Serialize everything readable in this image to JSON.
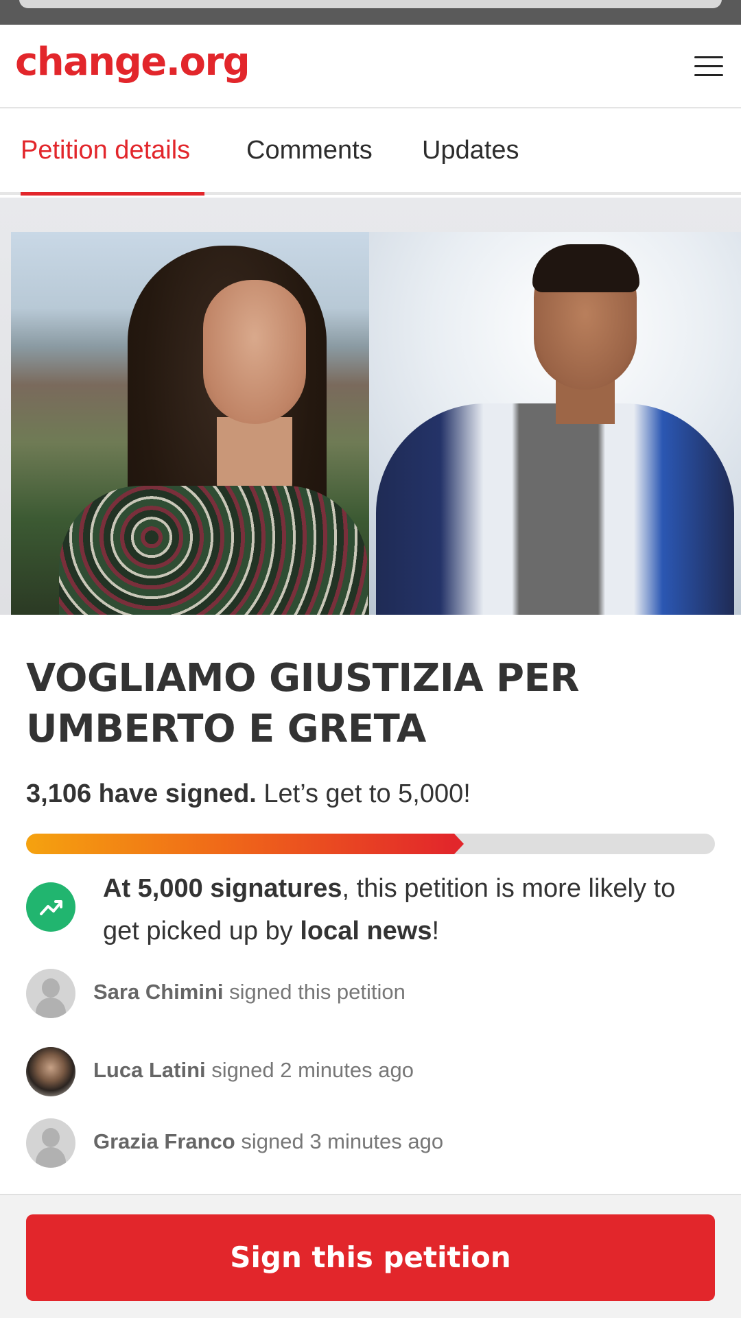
{
  "header": {
    "logo_text": "change.org",
    "menu_icon": "hamburger-icon"
  },
  "tabs": [
    {
      "label": "Petition details",
      "active": true
    },
    {
      "label": "Comments",
      "active": false
    },
    {
      "label": "Updates",
      "active": false
    }
  ],
  "petition": {
    "title": "VOGLIAMO GIUSTIZIA PER UMBERTO E GRETA",
    "signed_count_text": "3,106 have signed.",
    "goal_text": "Let’s get to 5,000!",
    "progress_fraction": 0.6212
  },
  "milestone": {
    "icon": "trending-up-icon",
    "bold_1": "At 5,000 signatures",
    "text_1": ", this petition is more likely to get picked up by ",
    "bold_2": "local news",
    "text_2": "!"
  },
  "signers": [
    {
      "name": "Sara Chimini",
      "action": " signed this petition",
      "avatar": "default-avatar-icon"
    },
    {
      "name": "Luca Latini",
      "action": " signed 2 minutes ago",
      "avatar": "user-photo"
    },
    {
      "name": "Grazia Franco",
      "action": " signed 3 minutes ago",
      "avatar": "default-avatar-icon"
    }
  ],
  "cta": {
    "label": "Sign this petition"
  },
  "colors": {
    "brand_red": "#e2262b",
    "milestone_green": "#21b56f",
    "progress_start": "#f5a20f"
  }
}
